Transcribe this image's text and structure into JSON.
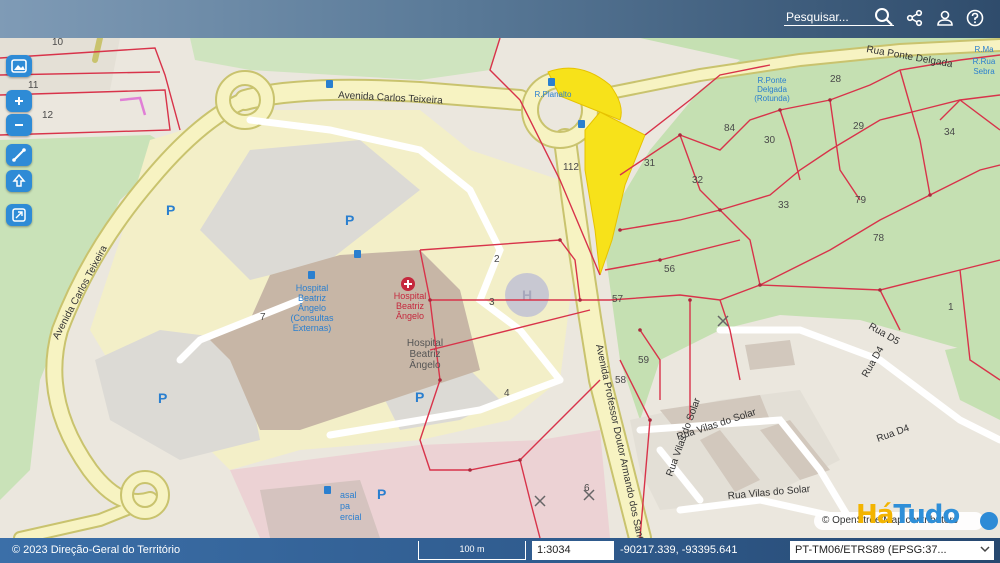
{
  "topbar": {
    "search_placeholder": "Pesquisar...",
    "icons": [
      "search-icon",
      "share-icon",
      "user-icon",
      "help-icon"
    ]
  },
  "tools": [
    "image-layer-icon",
    "zoom-in-icon",
    "zoom-out-icon",
    "measure-icon",
    "upload-icon",
    "fullscreen-icon"
  ],
  "map": {
    "streets": {
      "avenida_carlos_teixeira_top": "Avenida Carlos Teixeira",
      "avenida_carlos_teixeira_left": "Avenida Carlos Teixeira",
      "avenida_professor": "Avenida Professor Doutor Armando dos Sant",
      "rua_ponte_delgada": "Rua Ponte Delgada",
      "rua_vilas_do_solar_1": "Rua Vilas do Solar",
      "rua_vilas_do_solar_2": "Rua Vilas do Solar",
      "rua_vilas_do_solar_3": "Rua Vilas do Solar",
      "rua_d5": "Rua D5",
      "rua_d4_1": "Rua D4",
      "rua_d4_2": "Rua D4"
    },
    "places": {
      "hospital_consultas": [
        "Hospital",
        "Beatriz",
        "Ângelo",
        "(Consultas",
        "Externas)"
      ],
      "hospital_red": [
        "Hospital",
        "Beatriz",
        "Ângelo"
      ],
      "hospital_main": [
        "Hospital",
        "Beatriz",
        "Ângelo"
      ],
      "r_planalto": "R.Planalto",
      "r_ponte_delgada": [
        "R.Ponte",
        "Delgada",
        "(Rotunda)"
      ],
      "r_rua_right": [
        "R.Ma",
        "R.Rua",
        "Sebra"
      ],
      "casal": [
        "asal",
        "pa",
        "ercial"
      ],
      "parking": "P"
    },
    "parcel_numbers": [
      "10",
      "11",
      "12",
      "112",
      "2",
      "3",
      "4",
      "6",
      "7",
      "28",
      "29",
      "30",
      "31",
      "32",
      "33",
      "34",
      "56",
      "57",
      "58",
      "59",
      "78",
      "79",
      "84",
      "1"
    ],
    "highlight_color": "#f7e21a",
    "parcel_line_color": "#d8334a"
  },
  "attribution": {
    "symbol": "©",
    "text": "OpenStreetMap contributors"
  },
  "watermark": {
    "part1": "Há",
    "part2": "Tudo"
  },
  "bottombar": {
    "copyright": "© 2023 Direção-Geral do Território",
    "scale_label": "100 m",
    "scale_value": "1:3034",
    "coordinates": "-90217.339, -93395.641",
    "crs": "PT-TM06/ETRS89 (EPSG:37..."
  }
}
